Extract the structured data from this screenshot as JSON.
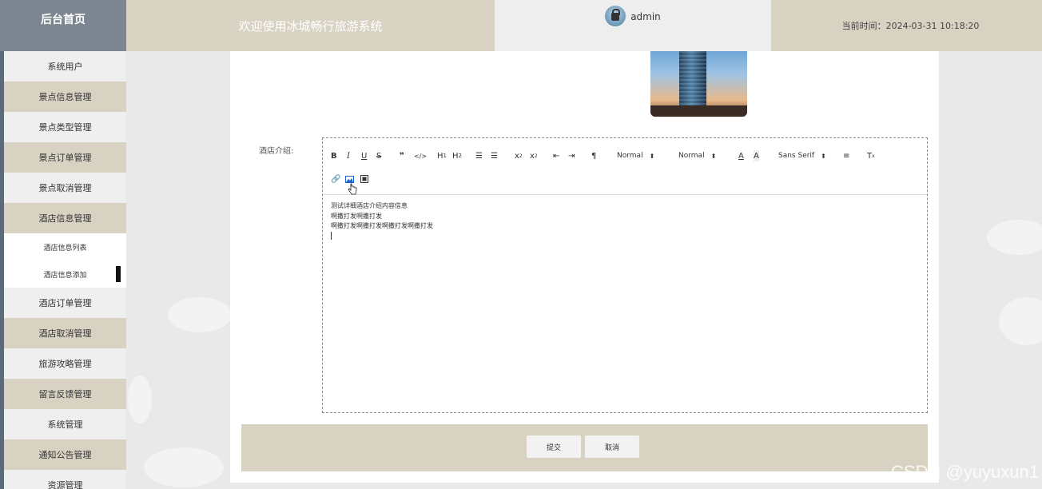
{
  "header": {
    "brand": "后台首页",
    "welcome": "欢迎使用冰城畅行旅游系统",
    "username": "admin",
    "time_label": "当前时间：",
    "time_value": "2024-03-31 10:18:20"
  },
  "sidebar": {
    "items": [
      {
        "label": "系统用户"
      },
      {
        "label": "景点信息管理"
      },
      {
        "label": "景点类型管理"
      },
      {
        "label": "景点订单管理"
      },
      {
        "label": "景点取消管理"
      },
      {
        "label": "酒店信息管理"
      },
      {
        "label": "酒店信息列表"
      },
      {
        "label": "酒店信息添加"
      },
      {
        "label": "酒店订单管理"
      },
      {
        "label": "酒店取消管理"
      },
      {
        "label": "旅游攻略管理"
      },
      {
        "label": "留言反馈管理"
      },
      {
        "label": "系统管理"
      },
      {
        "label": "通知公告管理"
      },
      {
        "label": "资源管理"
      }
    ]
  },
  "form": {
    "intro_label": "酒店介绍:",
    "editor": {
      "header_select": "Normal",
      "size_select": "Normal",
      "font_select": "Sans Serif",
      "content_lines": [
        "测试详细酒店介绍内容信息",
        "啊撒打发啊撒打发",
        "啊撒打发啊撒打发啊撒打发啊撒打发"
      ]
    },
    "submit_label": "提交",
    "cancel_label": "取消"
  },
  "watermark": "CSDN @yuyuxun1"
}
